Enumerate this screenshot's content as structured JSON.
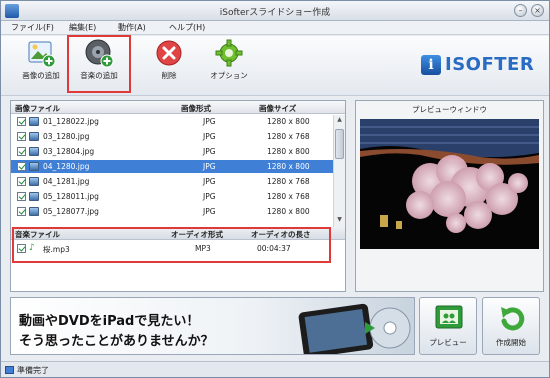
{
  "window": {
    "title": "iSofterスライドショー作成",
    "minimize": "–",
    "close": "×"
  },
  "menu": [
    "ファイル(F)",
    "編集(E)",
    "動作(A)",
    "ヘルプ(H)"
  ],
  "toolbar": {
    "add_image": "画像の追加",
    "add_music": "音楽の追加",
    "delete": "削除",
    "options": "オプション"
  },
  "logo": {
    "badge": "i",
    "text": "ISOFTER"
  },
  "image_table": {
    "headers": [
      "画像ファイル",
      "画像形式",
      "画像サイズ"
    ],
    "rows": [
      {
        "name": "01_128022.jpg",
        "format": "JPG",
        "size": "1280 x 800",
        "selected": false
      },
      {
        "name": "03_1280.jpg",
        "format": "JPG",
        "size": "1280 x 768",
        "selected": false
      },
      {
        "name": "03_12804.jpg",
        "format": "JPG",
        "size": "1280 x 800",
        "selected": false
      },
      {
        "name": "04_1280.jpg",
        "format": "JPG",
        "size": "1280 x 800",
        "selected": true
      },
      {
        "name": "04_1281.jpg",
        "format": "JPG",
        "size": "1280 x 768",
        "selected": false
      },
      {
        "name": "05_128011.jpg",
        "format": "JPG",
        "size": "1280 x 768",
        "selected": false
      },
      {
        "name": "05_128077.jpg",
        "format": "JPG",
        "size": "1280 x 800",
        "selected": false
      }
    ]
  },
  "audio_table": {
    "headers": [
      "音楽ファイル",
      "オーディオ形式",
      "オーディオの長さ"
    ],
    "rows": [
      {
        "name": "桜.mp3",
        "format": "MP3",
        "length": "00:04:37"
      }
    ]
  },
  "preview": {
    "title": "プレビューウィンドウ"
  },
  "banner": {
    "line1": "動画やDVDをiPadで見たい！",
    "line2": "そう思ったことがありませんか？"
  },
  "buttons": {
    "preview": "プレビュー",
    "create": "作成開始"
  },
  "status": {
    "text": "準備完了"
  }
}
